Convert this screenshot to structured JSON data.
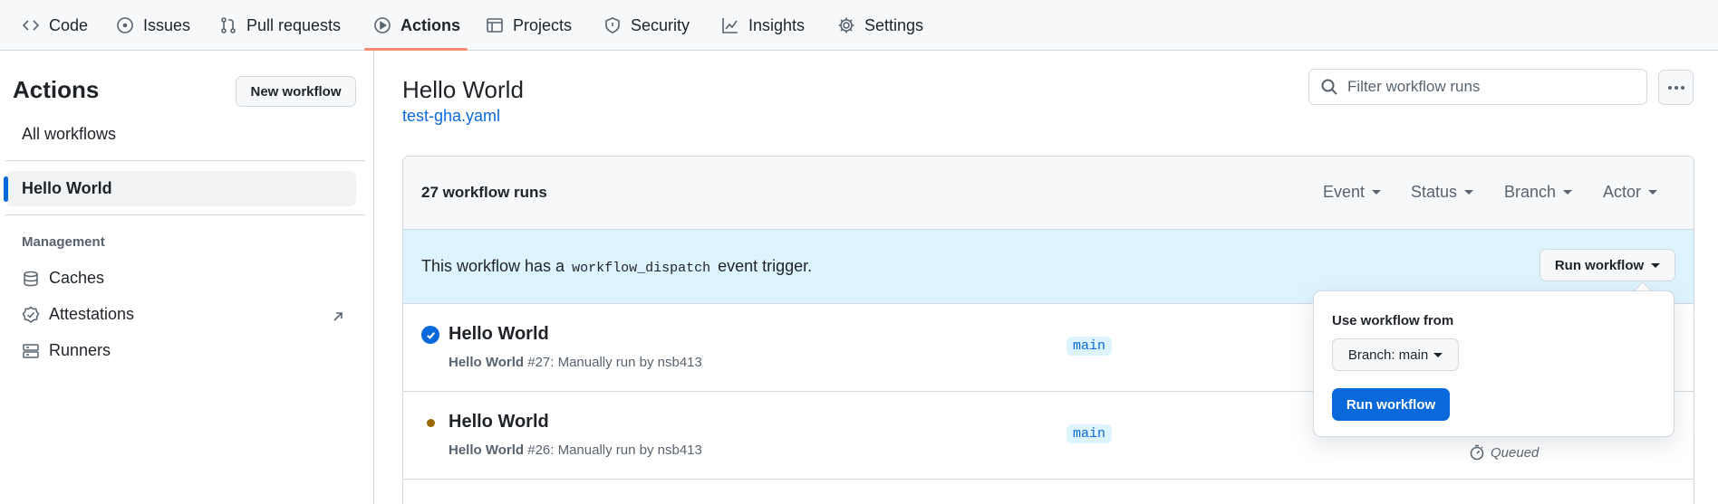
{
  "nav": {
    "tabs": [
      {
        "label": "Code",
        "icon": "code-icon"
      },
      {
        "label": "Issues",
        "icon": "issue-opened-icon"
      },
      {
        "label": "Pull requests",
        "icon": "git-pull-request-icon"
      },
      {
        "label": "Actions",
        "icon": "play-icon",
        "selected": true
      },
      {
        "label": "Projects",
        "icon": "table-icon"
      },
      {
        "label": "Security",
        "icon": "shield-icon"
      },
      {
        "label": "Insights",
        "icon": "graph-icon"
      },
      {
        "label": "Settings",
        "icon": "gear-icon"
      }
    ],
    "accent_color": "#fd8c73"
  },
  "sidebar": {
    "title": "Actions",
    "new_workflow_label": "New workflow",
    "all_workflows_label": "All workflows",
    "selected_workflow": "Hello World",
    "management_heading": "Management",
    "management_items": [
      {
        "label": "Caches",
        "icon": "database-icon"
      },
      {
        "label": "Attestations",
        "icon": "verified-icon"
      },
      {
        "label": "Runners",
        "icon": "server-icon"
      }
    ]
  },
  "main": {
    "title": "Hello World",
    "workflow_file": "test-gha.yaml",
    "search_placeholder": "Filter workflow runs",
    "runs_count": "27 workflow runs",
    "filters": [
      "Event",
      "Status",
      "Branch",
      "Actor"
    ],
    "dispatch": {
      "prefix": "This workflow has a",
      "code": "workflow_dispatch",
      "suffix": "event trigger.",
      "button_label": "Run workflow"
    },
    "runs": [
      {
        "title": "Hello World",
        "name": "Hello World",
        "detail": "#27: Manually run by nsb413",
        "branch": "main",
        "status": "success"
      },
      {
        "title": "Hello World",
        "name": "Hello World",
        "detail": "#26: Manually run by nsb413",
        "branch": "main",
        "status": "queued",
        "status_label": "Queued"
      }
    ]
  },
  "popover": {
    "label": "Use workflow from",
    "branch_button": "Branch: main",
    "run_button": "Run workflow",
    "primary_color": "#0969da"
  }
}
